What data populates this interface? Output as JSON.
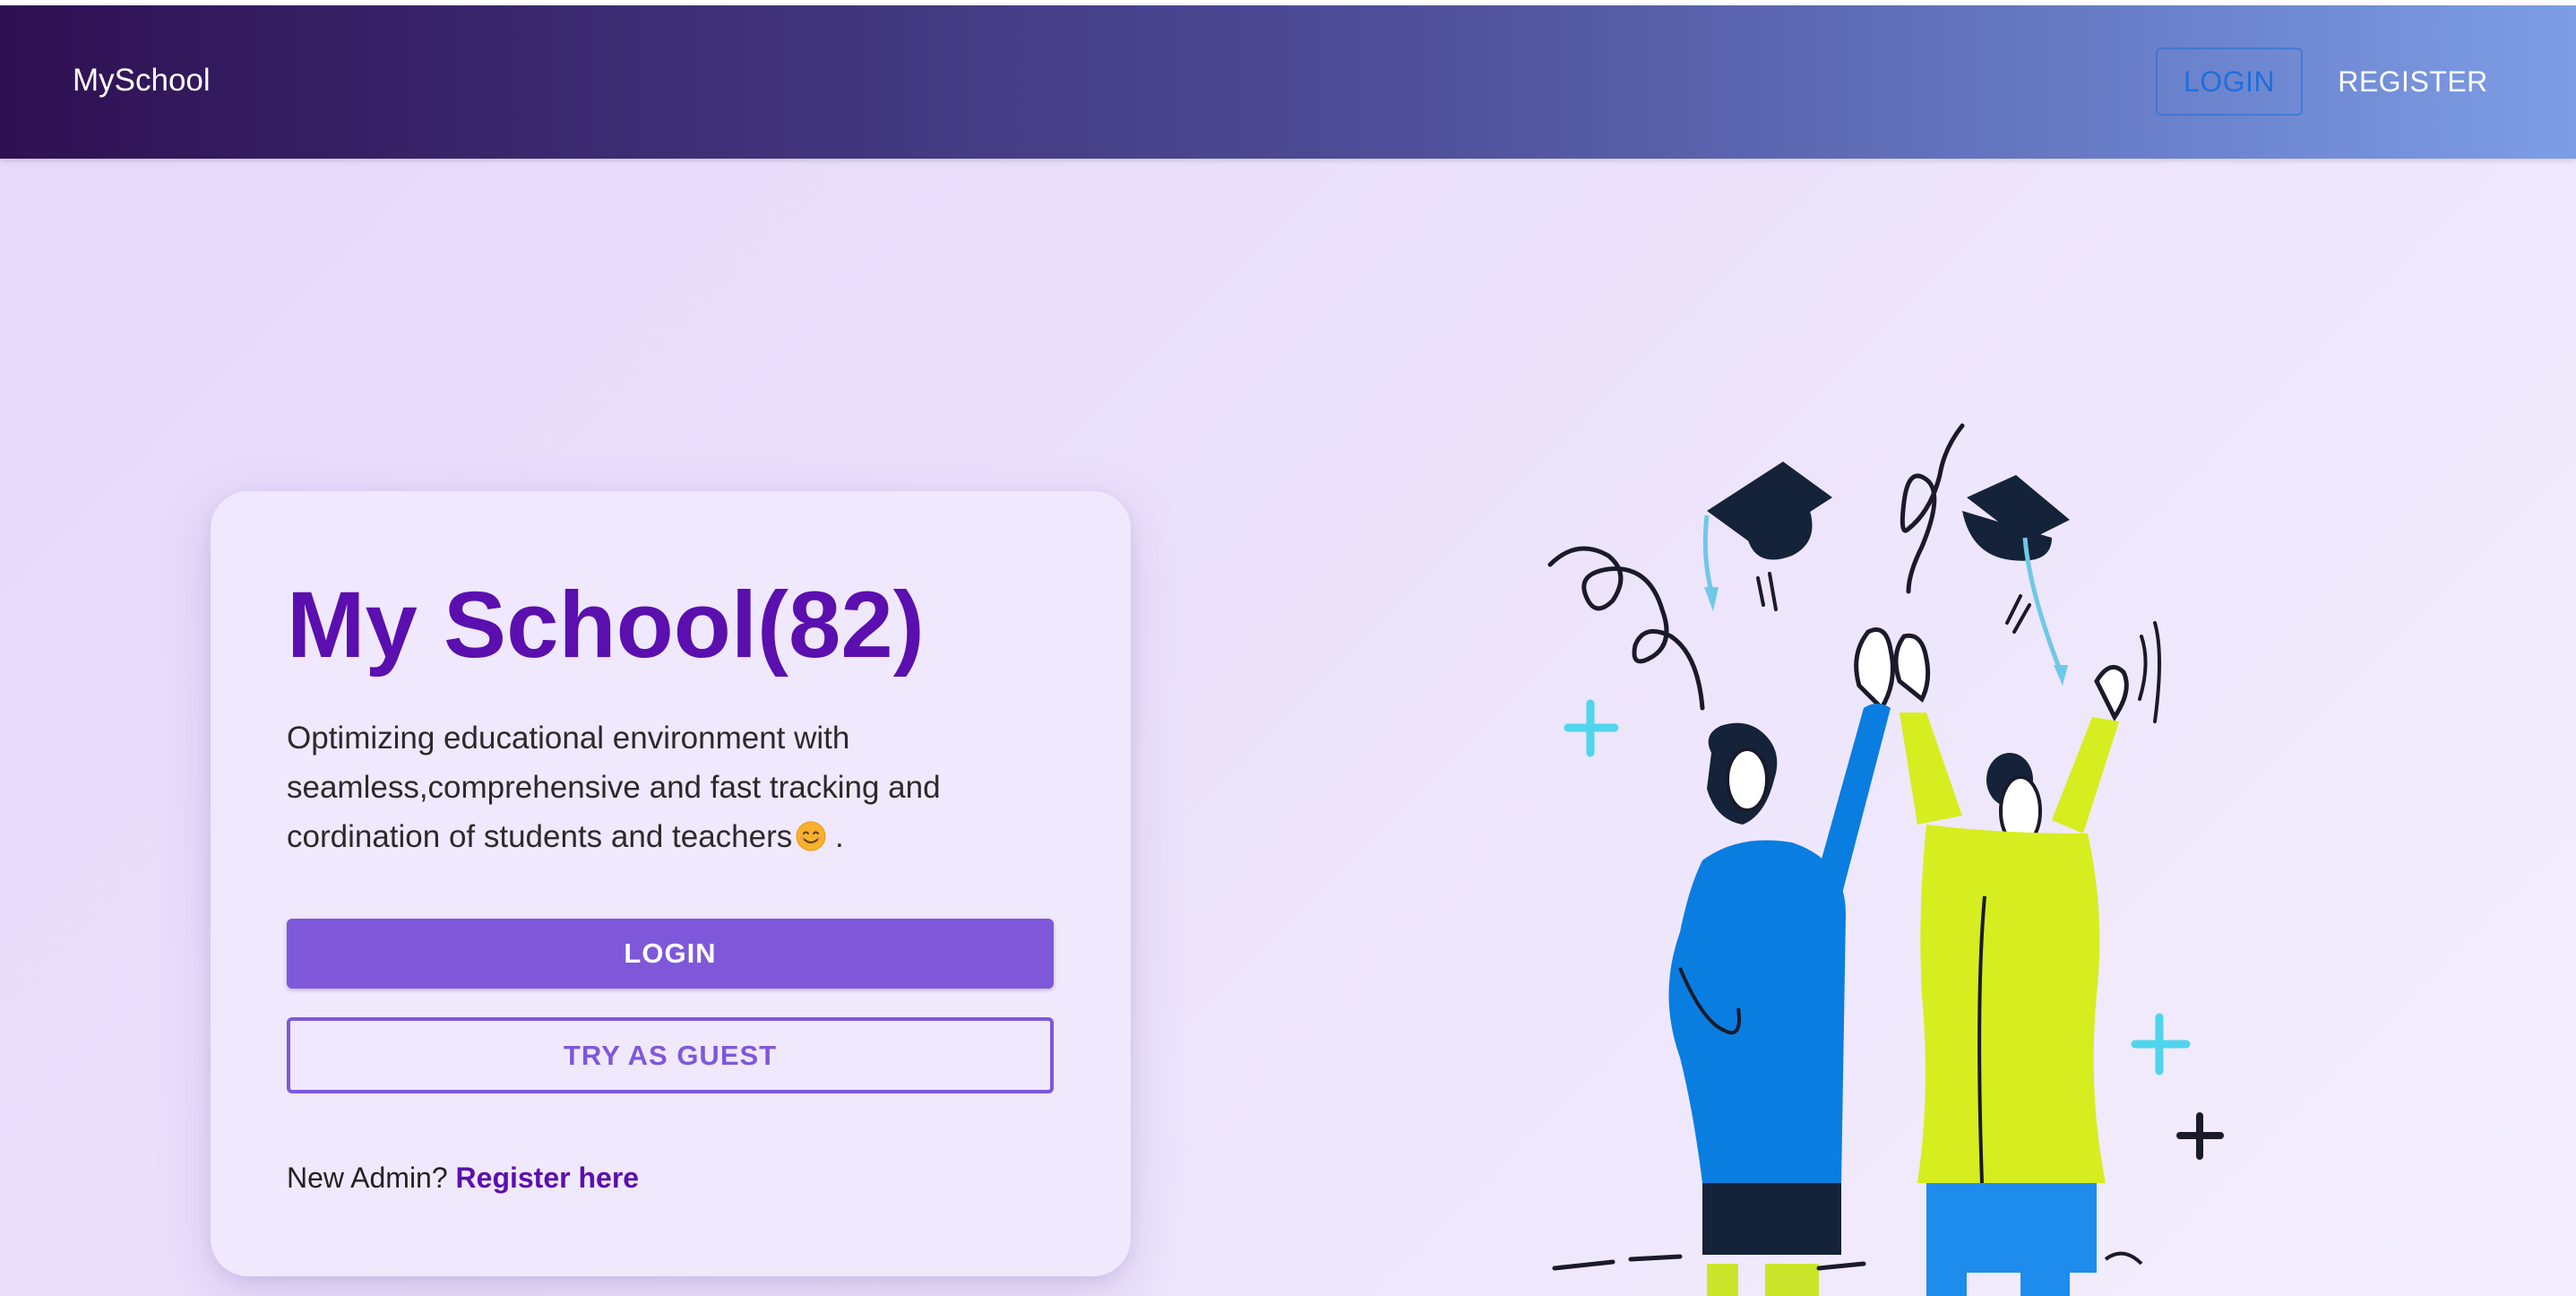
{
  "navbar": {
    "brand": "MySchool",
    "login_label": "LOGIN",
    "register_label": "REGISTER"
  },
  "hero": {
    "title": "My School(82)",
    "description": "Optimizing educational environment with seamless,comprehensive and fast tracking and cordination of students and teachers",
    "description_end": ".",
    "login_button": "LOGIN",
    "guest_button": "TRY AS GUEST",
    "footer_prompt": "New Admin?",
    "footer_link": "Register here"
  },
  "icons": {
    "emoji": "smiling-face-icon",
    "illustration": "graduates-celebrating-illustration"
  },
  "colors": {
    "accent": "#7e58d9",
    "title": "#5a0fae",
    "nav_start": "#2f1052",
    "nav_end": "#7d9ee6"
  }
}
